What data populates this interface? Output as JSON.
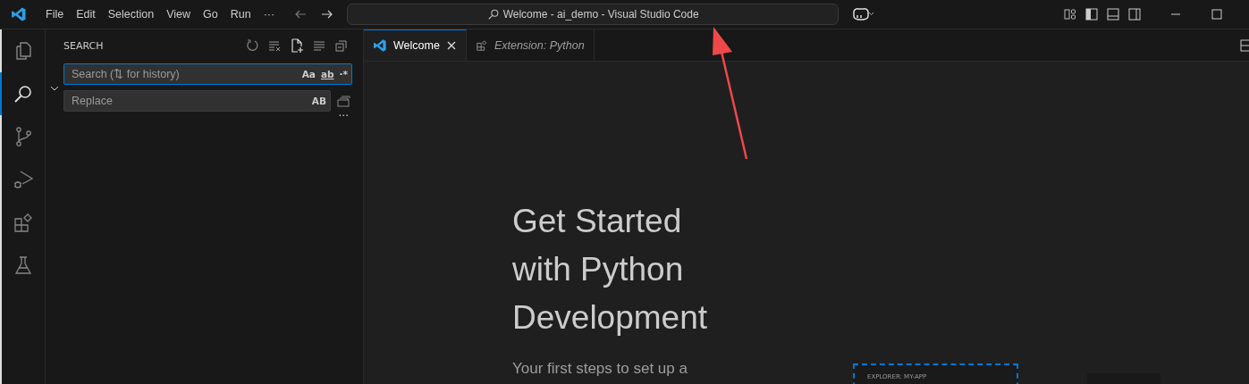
{
  "menu": [
    "File",
    "Edit",
    "Selection",
    "View",
    "Go",
    "Run",
    "···"
  ],
  "command_center": {
    "text": "Welcome - ai_demo - Visual Studio Code"
  },
  "activity_bar": [
    {
      "kind": "files",
      "selected": false
    },
    {
      "kind": "search",
      "selected": true
    },
    {
      "kind": "branch",
      "selected": false
    },
    {
      "kind": "run",
      "selected": false
    },
    {
      "kind": "extensions",
      "selected": false
    },
    {
      "kind": "flask",
      "selected": false
    }
  ],
  "sidebar": {
    "title": "SEARCH",
    "search": {
      "placeholder": "Search (⇅ for history)",
      "options": [
        "Aa",
        "ab",
        "·*"
      ]
    },
    "replace": {
      "placeholder": "Replace",
      "option": "AB"
    },
    "more": "···"
  },
  "tabs": [
    {
      "label": "Welcome",
      "selected": true,
      "kind": "welcome"
    },
    {
      "label": "Extension: Python",
      "selected": false,
      "kind": "extension"
    }
  ],
  "welcome": {
    "heading": "Get Started with Python Development",
    "subtitle": "Your first steps to set up a",
    "preview_label": "EXPLORER: MY-APP"
  }
}
